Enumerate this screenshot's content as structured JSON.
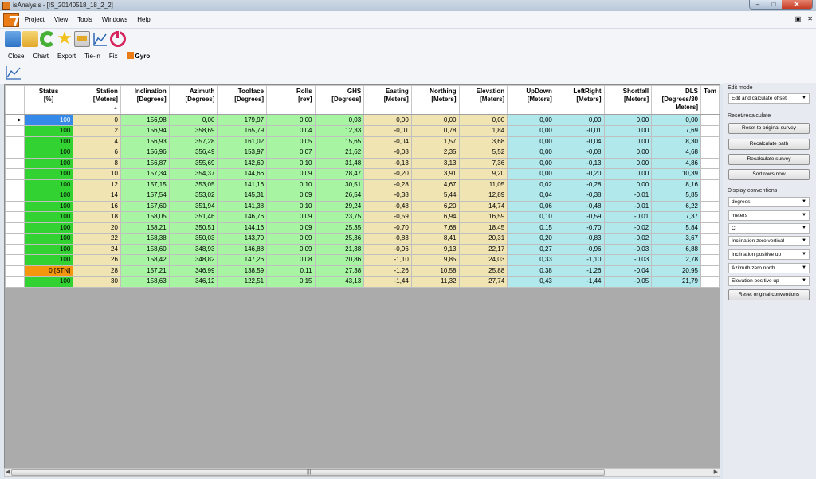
{
  "window": {
    "title": "isAnalysis - [IS_20140518_18_2_2]",
    "controls": {
      "minimize": "–",
      "maximize": "□",
      "close": "✕"
    }
  },
  "menu": {
    "items": [
      "Project",
      "View",
      "Tools",
      "Windows",
      "Help"
    ],
    "mdi_controls": [
      "_",
      "▣",
      "✕"
    ]
  },
  "toolbar": {
    "icons": [
      "new-icon",
      "open-folder-icon",
      "refresh-icon",
      "star-icon",
      "print-icon",
      "chart-icon",
      "power-icon"
    ]
  },
  "subtoolbar": {
    "items": [
      "Close",
      "Chart",
      "Export",
      "Tie-in",
      "Fix"
    ],
    "gyro_label": "Gyro"
  },
  "grid": {
    "columns": [
      {
        "name": "Status",
        "unit": "[%]"
      },
      {
        "name": "Station",
        "unit": "[Meters]"
      },
      {
        "name": "Inclination",
        "unit": "[Degrees]"
      },
      {
        "name": "Azimuth",
        "unit": "[Degrees]"
      },
      {
        "name": "Toolface",
        "unit": "[Degrees]"
      },
      {
        "name": "Rolls",
        "unit": "[rev]"
      },
      {
        "name": "GHS",
        "unit": "[Degrees]"
      },
      {
        "name": "Easting",
        "unit": "[Meters]"
      },
      {
        "name": "Northing",
        "unit": "[Meters]"
      },
      {
        "name": "Elevation",
        "unit": "[Meters]"
      },
      {
        "name": "UpDown",
        "unit": "[Meters]"
      },
      {
        "name": "LeftRight",
        "unit": "[Meters]"
      },
      {
        "name": "Shortfall",
        "unit": "[Meters]"
      },
      {
        "name": "DLS",
        "unit": "[Degrees/30",
        "unit2": "Meters]"
      },
      {
        "name": "Tem",
        "unit": ""
      }
    ],
    "rows": [
      [
        "100",
        "0",
        "156,98",
        "0,00",
        "179,97",
        "0,00",
        "0,03",
        "0,00",
        "0,00",
        "0,00",
        "0,00",
        "0,00",
        "0,00",
        "0,00"
      ],
      [
        "100",
        "2",
        "156,94",
        "358,69",
        "165,79",
        "0,04",
        "12,33",
        "-0,01",
        "0,78",
        "1,84",
        "0,00",
        "-0,01",
        "0,00",
        "7,69"
      ],
      [
        "100",
        "4",
        "156,93",
        "357,28",
        "161,02",
        "0,05",
        "15,65",
        "-0,04",
        "1,57",
        "3,68",
        "0,00",
        "-0,04",
        "0,00",
        "8,30"
      ],
      [
        "100",
        "6",
        "156,96",
        "356,49",
        "153,97",
        "0,07",
        "21,62",
        "-0,08",
        "2,35",
        "5,52",
        "0,00",
        "-0,08",
        "0,00",
        "4,68"
      ],
      [
        "100",
        "8",
        "156,87",
        "355,69",
        "142,69",
        "0,10",
        "31,48",
        "-0,13",
        "3,13",
        "7,36",
        "0,00",
        "-0,13",
        "0,00",
        "4,86"
      ],
      [
        "100",
        "10",
        "157,34",
        "354,37",
        "144,66",
        "0,09",
        "28,47",
        "-0,20",
        "3,91",
        "9,20",
        "0,00",
        "-0,20",
        "0,00",
        "10,39"
      ],
      [
        "100",
        "12",
        "157,15",
        "353,05",
        "141,16",
        "0,10",
        "30,51",
        "-0,28",
        "4,67",
        "11,05",
        "0,02",
        "-0,28",
        "0,00",
        "8,16"
      ],
      [
        "100",
        "14",
        "157,54",
        "353,02",
        "145,31",
        "0,09",
        "26,54",
        "-0,38",
        "5,44",
        "12,89",
        "0,04",
        "-0,38",
        "-0,01",
        "5,85"
      ],
      [
        "100",
        "16",
        "157,60",
        "351,94",
        "141,38",
        "0,10",
        "29,24",
        "-0,48",
        "6,20",
        "14,74",
        "0,06",
        "-0,48",
        "-0,01",
        "6,22"
      ],
      [
        "100",
        "18",
        "158,05",
        "351,46",
        "146,76",
        "0,09",
        "23,75",
        "-0,59",
        "6,94",
        "16,59",
        "0,10",
        "-0,59",
        "-0,01",
        "7,37"
      ],
      [
        "100",
        "20",
        "158,21",
        "350,51",
        "144,16",
        "0,09",
        "25,35",
        "-0,70",
        "7,68",
        "18,45",
        "0,15",
        "-0,70",
        "-0,02",
        "5,84"
      ],
      [
        "100",
        "22",
        "158,38",
        "350,03",
        "143,70",
        "0,09",
        "25,36",
        "-0,83",
        "8,41",
        "20,31",
        "0,20",
        "-0,83",
        "-0,02",
        "3,67"
      ],
      [
        "100",
        "24",
        "158,60",
        "348,93",
        "146,88",
        "0,09",
        "21,38",
        "-0,96",
        "9,13",
        "22,17",
        "0,27",
        "-0,96",
        "-0,03",
        "6,88"
      ],
      [
        "100",
        "26",
        "158,42",
        "348,82",
        "147,26",
        "0,08",
        "20,86",
        "-1,10",
        "9,85",
        "24,03",
        "0,33",
        "-1,10",
        "-0,03",
        "2,78"
      ],
      [
        "0 [STN]",
        "28",
        "157,21",
        "346,99",
        "138,59",
        "0,11",
        "27,38",
        "-1,26",
        "10,58",
        "25,88",
        "0,38",
        "-1,26",
        "-0,04",
        "20,95"
      ],
      [
        "100",
        "30",
        "158,63",
        "346,12",
        "122,51",
        "0,15",
        "43,13",
        "-1,44",
        "11,32",
        "27,74",
        "0,43",
        "-1,44",
        "-0,05",
        "21,79"
      ]
    ],
    "selected_row": 0,
    "sorted_column": "Station",
    "scrollbar_grip": "|||"
  },
  "side_panel": {
    "edit_mode_label": "Edit mode",
    "edit_mode_value": "Edit and calculate offset",
    "reset_label": "Reset/recalculate",
    "buttons": [
      "Reset to original survey",
      "Recalculate path",
      "Recalculate survey",
      "Sort rows now"
    ],
    "display_label": "Display conventions",
    "selects": [
      "degrees",
      "meters",
      "C",
      "Inclination zero vertical",
      "Inclination positive up",
      "Azimuth zero north",
      "Elevation positive up"
    ],
    "reset_conventions": "Reset original conventions"
  },
  "colors": {
    "status_green": "#32d232",
    "status_blue": "#3589e8",
    "status_orange": "#f5960f",
    "cream": "#f1e4b3",
    "green": "#a7f4a3",
    "cyan": "#b0e8eb"
  }
}
